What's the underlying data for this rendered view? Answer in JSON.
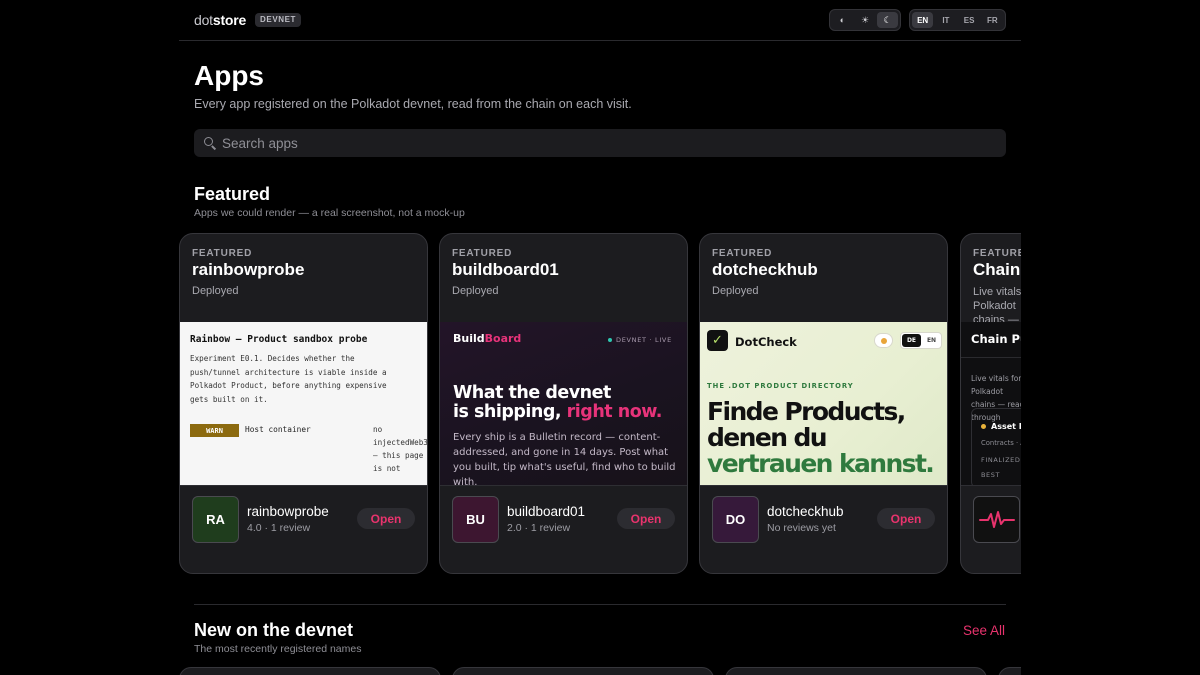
{
  "header": {
    "logo_dot": "dot",
    "logo_store": "store",
    "network_badge": "DEVNET",
    "theme_options": [
      {
        "icon": "contrast-icon",
        "glyph": "◐"
      },
      {
        "icon": "sun-icon",
        "glyph": "☀"
      },
      {
        "icon": "moon-icon",
        "glyph": "☾",
        "active": true
      }
    ],
    "languages": [
      {
        "code": "EN",
        "active": true
      },
      {
        "code": "IT"
      },
      {
        "code": "ES"
      },
      {
        "code": "FR"
      }
    ]
  },
  "page": {
    "title": "Apps",
    "subtitle": "Every app registered on the Polkadot devnet, read from the chain on each visit."
  },
  "search": {
    "placeholder": "Search apps",
    "value": ""
  },
  "featured": {
    "title": "Featured",
    "subtitle": "Apps we could render — a real screenshot, not a mock-up",
    "cards": [
      {
        "kicker": "FEATURED",
        "name": "rainbowprobe",
        "status": "Deployed",
        "avatar": "RA",
        "app_name": "rainbowprobe",
        "meta": "4.0 · 1 review",
        "open_label": "Open",
        "shot": {
          "title": "Rainbow — Product sandbox probe",
          "text": "Experiment E0.1. Decides whether the push/tunnel architecture is viable inside a Polkadot Product, before anything expensive gets built on it.",
          "warn": "WARN",
          "host": "Host container",
          "side": "no injectedWeb3 — this page is not"
        }
      },
      {
        "kicker": "FEATURED",
        "name": "buildboard01",
        "status": "Deployed",
        "avatar": "BU",
        "app_name": "buildboard01",
        "meta": "2.0 · 1 review",
        "open_label": "Open",
        "shot": {
          "logo_a": "Build",
          "logo_b": "Board",
          "live": "DEVNET · LIVE",
          "head_1": "What the devnet",
          "head_2a": "is shipping, ",
          "head_2b": "right now.",
          "body": "Every ship is a Bulletin record — content-addressed, and gone in 14 days. Post what you built, tip what's useful, find who to build with."
        }
      },
      {
        "kicker": "FEATURED",
        "name": "dotcheckhub",
        "status": "Deployed",
        "avatar": "DO",
        "app_name": "dotcheckhub",
        "meta": "No reviews yet",
        "open_label": "Open",
        "shot": {
          "mark": "✓",
          "name": "DotCheck",
          "lang_de": "DE",
          "lang_en": "EN",
          "kicker": "THE .DOT PRODUCT DIRECTORY",
          "head_1": "Finde Products,",
          "head_2": "denen du",
          "head_3": "vertrauen kannst."
        }
      },
      {
        "kicker": "FEATURED",
        "name": "Chain Pulse",
        "status": "Live vitals for Polkadot chains — read through",
        "shot": {
          "title": "Chain Pulse",
          "text": "Live vitals for Polkadot chains — read through",
          "asset": "Asset Hub",
          "l1": "Contracts · Asset Hub",
          "l2": "FINALIZED",
          "l3": "BEST"
        }
      }
    ]
  },
  "new_section": {
    "title": "New on the devnet",
    "subtitle": "The most recently registered names",
    "see_all": "See All"
  },
  "colors": {
    "accent": "#e8336d",
    "background": "#000000",
    "card": "#1c1c1f",
    "avatar_ra": "#1f3d1d",
    "avatar_bu": "#3d1630",
    "avatar_do": "#36193a"
  }
}
